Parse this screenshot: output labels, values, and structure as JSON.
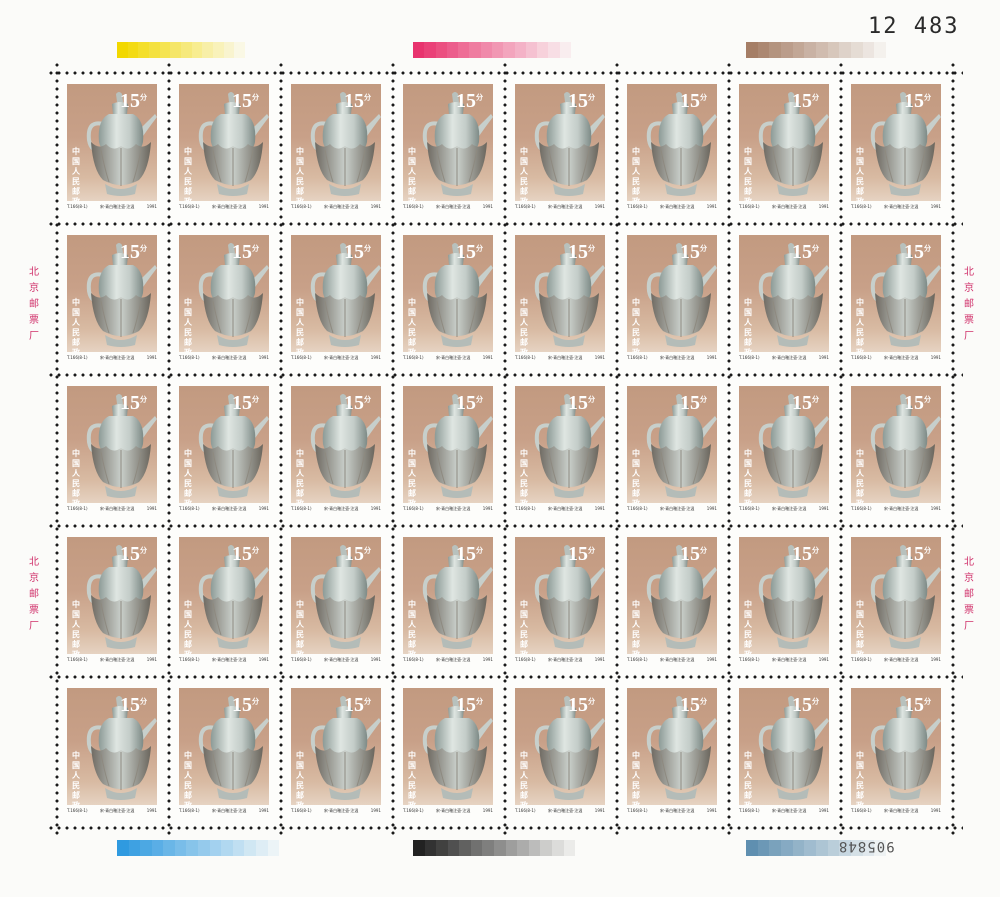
{
  "sheet": {
    "serial_top": "12 483",
    "serial_bottom": "905848",
    "side_text": "北京邮票厂",
    "rows": 5,
    "cols": 8
  },
  "stamp": {
    "denomination": "15",
    "denomination_suffix": "分",
    "country": "中国人民邮政",
    "code": "T.166(8-1)",
    "title": "宋·青白釉注壶·注温",
    "year": "1991"
  },
  "colors": {
    "yellow": "#f2d800",
    "magenta": "#e8336e",
    "brown": "#a57e66",
    "cyan": "#2f9ae0",
    "black": "#222222",
    "steel": "#5f8fb0",
    "stamp_bg": "#c29a80"
  }
}
